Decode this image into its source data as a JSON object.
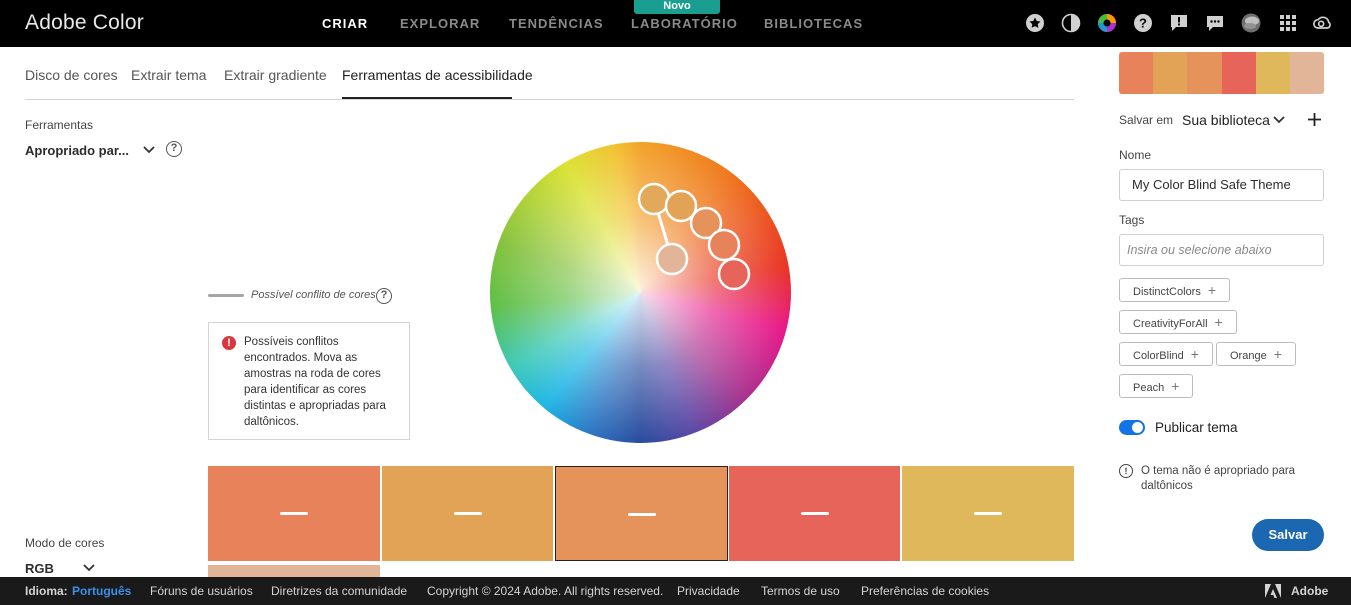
{
  "app": {
    "title": "Adobe Color"
  },
  "topnav": {
    "items": [
      {
        "label": "CRIAR",
        "active": true
      },
      {
        "label": "EXPLORAR",
        "active": false
      },
      {
        "label": "TENDÊNCIAS",
        "active": false
      },
      {
        "label": "LABORATÓRIO",
        "active": false
      },
      {
        "label": "BIBLIOTECAS",
        "active": false
      }
    ],
    "badge": "Novo",
    "icons": [
      "star-icon",
      "contrast-icon",
      "color-wheel-icon",
      "help-icon",
      "feedback-icon",
      "chat-icon",
      "avatar",
      "apps-grid-icon",
      "creative-cloud-icon"
    ]
  },
  "tabs": [
    {
      "label": "Disco de cores"
    },
    {
      "label": "Extrair tema"
    },
    {
      "label": "Extrair gradiente"
    },
    {
      "label": "Ferramentas de acessibilidade",
      "active": true
    }
  ],
  "tools": {
    "label": "Ferramentas",
    "selected": "Apropriado par...",
    "help": "?"
  },
  "legend": {
    "text": "Possível conflito de cores",
    "help": "?"
  },
  "conflict": {
    "icon": "!",
    "text": "Possíveis conflitos encontrados. Mova as amostras na roda de cores para identificar as cores distintas e apropriadas para daltônicos."
  },
  "swatches": [
    {
      "color": "#e8825a",
      "selected": false
    },
    {
      "color": "#e3a356",
      "selected": false
    },
    {
      "color": "#e5935b",
      "selected": true
    },
    {
      "color": "#e6645a",
      "selected": false
    },
    {
      "color": "#deb85a",
      "selected": false
    },
    {
      "color": "#e3b598",
      "selected": false
    }
  ],
  "color_mode": {
    "label": "Modo de cores",
    "value": "RGB"
  },
  "right": {
    "save_in_label": "Salvar em",
    "library": "Sua biblioteca",
    "name_label": "Nome",
    "name_value": "My Color Blind Safe Theme",
    "tags_label": "Tags",
    "tags_placeholder": "Insira ou selecione abaixo",
    "tags": [
      "DistinctColors",
      "CreativityForAll",
      "ColorBlind",
      "Orange",
      "Peach"
    ],
    "publish_label": "Publicar tema",
    "publish_on": true,
    "info_icon": "!",
    "info_text": "O tema não é apropriado para daltônicos",
    "save_button": "Salvar"
  },
  "footer": {
    "language_label": "Idioma:",
    "language_value": "Português",
    "links": [
      "Fóruns de usuários",
      "Diretrizes da comunidade",
      "Copyright © 2024 Adobe. All rights reserved.",
      "Privacidade",
      "Termos de uso",
      "Preferências de cookies"
    ],
    "adobe": "Adobe"
  }
}
